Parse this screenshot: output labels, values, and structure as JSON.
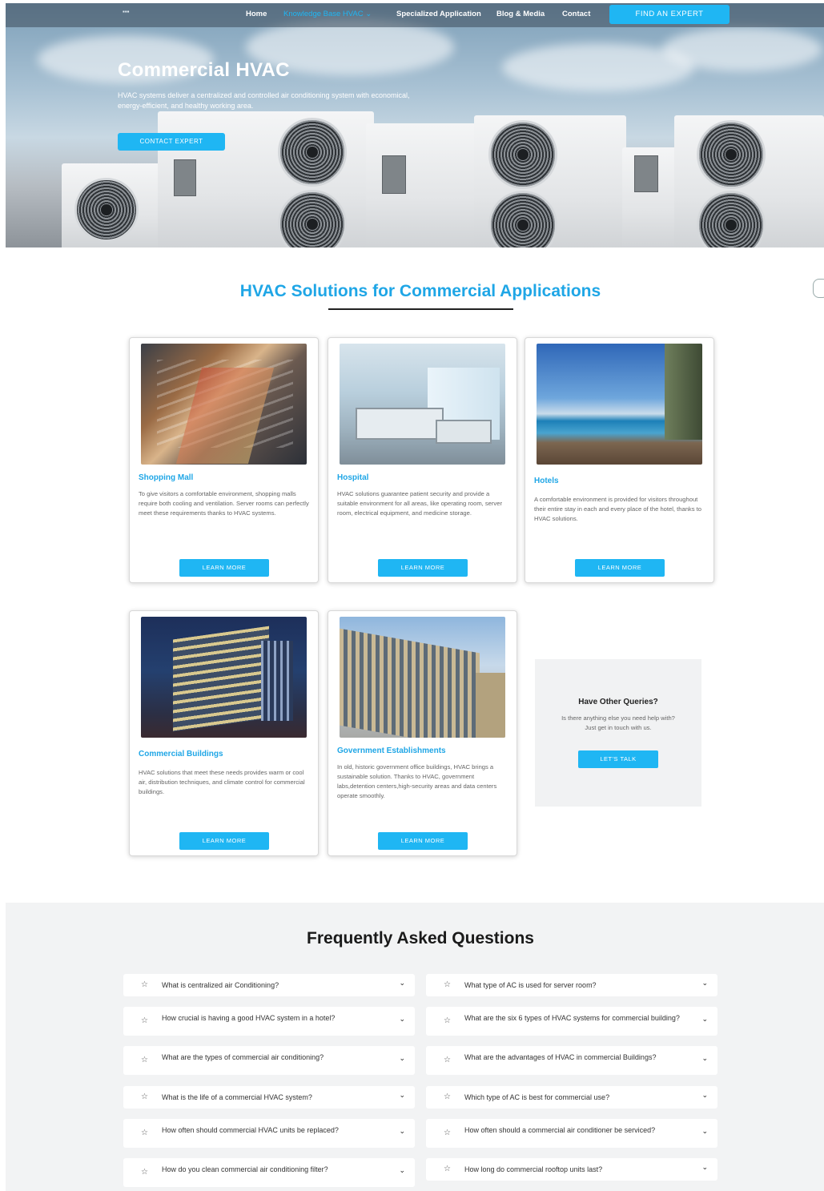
{
  "nav": {
    "logo": "▪▪▪",
    "items": [
      "Home",
      "Knowledge Base HVAC ⌄",
      "Specialized Application",
      "Blog & Media",
      "Contact"
    ],
    "cta": "FIND AN EXPERT"
  },
  "hero": {
    "title": "Commercial HVAC",
    "subtitle": "HVAC systems deliver a centralized and controlled air conditioning system with economical, energy-efficient, and healthy working area.",
    "button": "CONTACT EXPERT"
  },
  "solutions": {
    "title": "HVAC Solutions for Commercial Applications",
    "cards": [
      {
        "title": "Shopping Mall",
        "text": "To give visitors a comfortable environment, shopping malls require both cooling and ventilation. Server rooms can perfectly meet these requirements thanks to HVAC systems.",
        "button": "LEARN MORE"
      },
      {
        "title": "Hospital",
        "text": "HVAC solutions guarantee patient security and provide a suitable environment for all areas, like operating room, server room, electrical equipment, and medicine storage.",
        "button": "LEARN MORE"
      },
      {
        "title": "Hotels",
        "text": "A comfortable environment is provided for visitors throughout their entire stay in each and every place of the hotel, thanks to HVAC solutions.",
        "button": "LEARN MORE"
      },
      {
        "title": "Commercial Buildings",
        "text": "HVAC solutions that meet these needs provides warm or cool air, distribution techniques, and climate control for commercial buildings.",
        "button": "LEARN MORE"
      },
      {
        "title": "Government Establishments",
        "text": "In old, historic government office buildings, HVAC brings a sustainable solution. Thanks to HVAC, government labs,detention centers,high-security areas and data centers operate smoothly.",
        "button": "LEARN MORE"
      }
    ],
    "query": {
      "title": "Have Other Queries?",
      "text": "Is there anything else you need help with? Just get in touch with us.",
      "button": "LET'S TALK"
    }
  },
  "faq": {
    "title": "Frequently Asked Questions",
    "left": [
      "What is centralized air Conditioning?",
      "How crucial is having a good HVAC system in a hotel?",
      "What are the types of commercial air conditioning?",
      "What is the life of a commercial HVAC system?",
      "How often should commercial HVAC units be replaced?",
      "How do you clean commercial air conditioning filter?"
    ],
    "right": [
      "What type of AC is used for server room?",
      "What are the six 6 types of HVAC systems for commercial building?",
      "What are the advantages of HVAC in commercial Buildings?",
      "Which type of AC is best for commercial use?",
      "How often should a commercial air conditioner be serviced?",
      "How long do commercial rooftop units last?"
    ],
    "star": "☆",
    "chevron": "⌄"
  }
}
